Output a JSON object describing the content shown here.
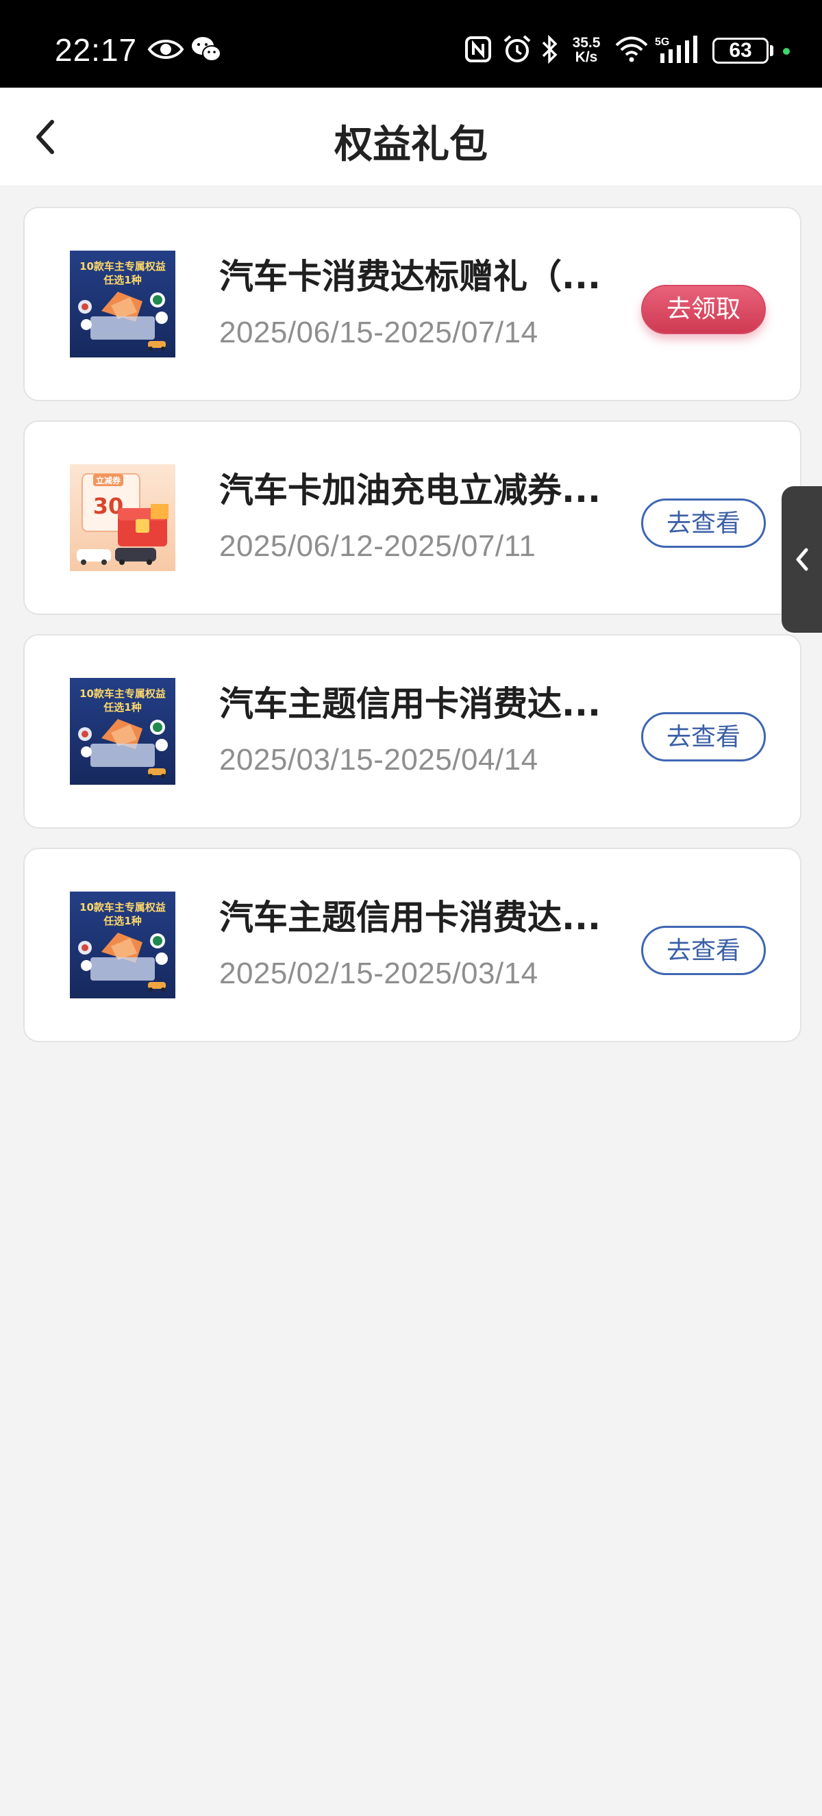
{
  "status_bar": {
    "time": "22:17",
    "net_speed_value": "35.5",
    "net_speed_unit": "K/s",
    "network_type": "5G",
    "battery_level": "63",
    "icons": [
      "eye-icon",
      "wechat-icon",
      "nfc-icon",
      "alarm-icon",
      "bluetooth-icon",
      "wifi-icon",
      "signal-icon",
      "battery-icon"
    ]
  },
  "header": {
    "title": "权益礼包",
    "back_icon": "chevron-left-icon"
  },
  "packages": [
    {
      "title": "汽车卡消费达标赠礼（...",
      "period": "2025/06/15-2025/07/14",
      "action": "去领取",
      "action_type": "claim",
      "thumb": {
        "type": "car-rights",
        "line1": "10款车主专属权益",
        "line2": "任选1种"
      }
    },
    {
      "title": "汽车卡加油充电立减券...",
      "period": "2025/06/12-2025/07/11",
      "action": "去查看",
      "action_type": "view",
      "thumb": {
        "type": "coupon",
        "line1": "立减券",
        "line2": "30"
      }
    },
    {
      "title": "汽车主题信用卡消费达...",
      "period": "2025/03/15-2025/04/14",
      "action": "去查看",
      "action_type": "view",
      "thumb": {
        "type": "car-rights",
        "line1": "10款车主专属权益",
        "line2": "任选1种"
      }
    },
    {
      "title": "汽车主题信用卡消费达...",
      "period": "2025/02/15-2025/03/14",
      "action": "去查看",
      "action_type": "view",
      "thumb": {
        "type": "car-rights",
        "line1": "10款车主专属权益",
        "line2": "任选1种"
      }
    }
  ],
  "side_handle": {
    "icon": "chevron-left-icon"
  },
  "colors": {
    "claim_button": "#d64863",
    "view_button": "#3e66b3",
    "background": "#f3f3f3",
    "thumb_blue": "#1f3a7a"
  }
}
